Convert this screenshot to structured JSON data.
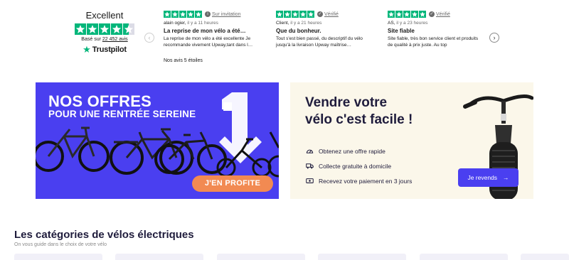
{
  "trustpilot": {
    "rating_word": "Excellent",
    "based_on_prefix": "Basé sur",
    "review_count": "22 452 avis",
    "logo_text": "Trustpilot",
    "stars_value": 4.5,
    "reviews_note": "Nos avis 5 étoiles",
    "reviews": [
      {
        "badge": "Sur invitation",
        "author": "alain ogier,",
        "time": "il y a 11 heures",
        "title": "La reprise de mon vélo a été…",
        "body": "La reprise de mon vélo a été excellente Je recommande vivement Upway,tant dans l…",
        "stars": 5
      },
      {
        "badge": "Vérifié",
        "author": "Client,",
        "time": "il y a 21 heures",
        "title": "Que du bonheur.",
        "body": "Tout s'est bien passé, du descriptif du vélo jusqu'à la livraison Upway maîtrise…",
        "stars": 5
      },
      {
        "badge": "Vérifié",
        "author": "AS,",
        "time": "il y a 23 heures",
        "title": "Site fiable",
        "body": "Site fiable, très bon service client et produits de qualité à prix juste. Au top",
        "stars": 5
      }
    ],
    "colors": {
      "star_green": "#00b67a",
      "star_empty": "#dcdce6"
    }
  },
  "promo": {
    "line1": "NOS OFFRES",
    "line2": "POUR UNE RENTRÉE SEREINE",
    "cta_label": "J'EN PROFITE",
    "background": "#4a3ff0",
    "cta_color": "#f28a52"
  },
  "sell": {
    "title_line1": "Vendre votre",
    "title_line2": "vélo c'est facile !",
    "benefits": [
      {
        "icon": "speedometer-icon",
        "text": "Obtenez une offre rapide"
      },
      {
        "icon": "truck-icon",
        "text": "Collecte gratuite à domicile"
      },
      {
        "icon": "cash-icon",
        "text": "Recevez votre paiement en 3 jours"
      }
    ],
    "cta_label": "Je revends",
    "background": "#fbf7ea",
    "accent": "#4a3ff0"
  },
  "categories": {
    "title": "Les catégories de vélos électriques",
    "subtitle": "On vous guide dans le choix de votre vélo"
  }
}
